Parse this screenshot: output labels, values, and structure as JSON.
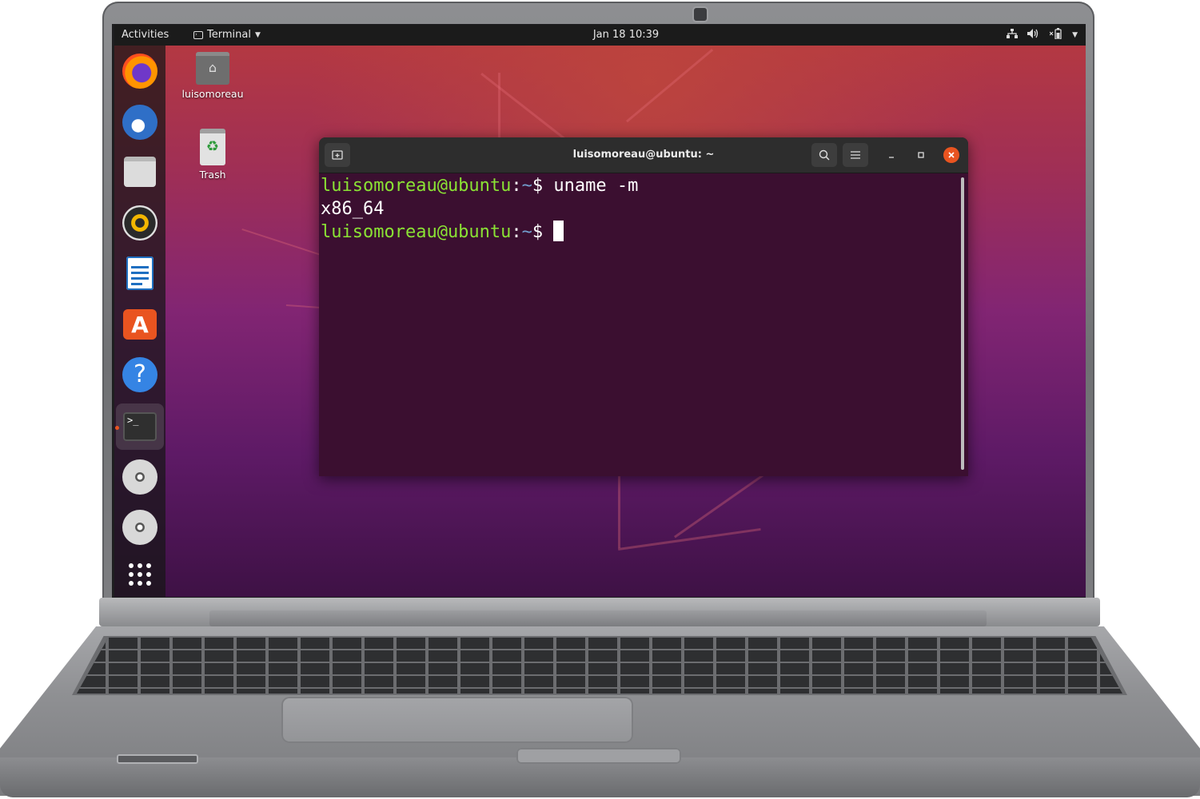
{
  "topbar": {
    "activities": "Activities",
    "app_menu": "Terminal",
    "clock": "Jan 18  10:39"
  },
  "dock": {
    "items": [
      {
        "name": "Firefox",
        "icon": "firefox-icon"
      },
      {
        "name": "Thunderbird",
        "icon": "thunderbird-icon"
      },
      {
        "name": "Files",
        "icon": "files-icon"
      },
      {
        "name": "Rhythmbox",
        "icon": "rhythmbox-icon"
      },
      {
        "name": "LibreOffice Writer",
        "icon": "writer-icon"
      },
      {
        "name": "Ubuntu Software",
        "icon": "software-center-icon"
      },
      {
        "name": "Help",
        "icon": "help-icon"
      },
      {
        "name": "Terminal",
        "icon": "terminal-icon",
        "active": true
      },
      {
        "name": "Disc",
        "icon": "disc-icon"
      },
      {
        "name": "Disc",
        "icon": "disc-icon"
      },
      {
        "name": "Show Applications",
        "icon": "app-grid-icon"
      }
    ]
  },
  "desktop": {
    "icons": [
      {
        "label": "luisomoreau",
        "icon": "home-folder-icon"
      },
      {
        "label": "Trash",
        "icon": "trash-icon"
      }
    ]
  },
  "terminal": {
    "title": "luisomoreau@ubuntu: ~",
    "lines": [
      {
        "user_host": "luisomoreau@ubuntu",
        "sep": ":",
        "path": "~",
        "prompt": "$ ",
        "command": "uname -m"
      },
      {
        "output": "x86_64"
      },
      {
        "user_host": "luisomoreau@ubuntu",
        "sep": ":",
        "path": "~",
        "prompt": "$ ",
        "command": ""
      }
    ]
  },
  "colors": {
    "ubuntu_orange": "#e95420",
    "prompt_green": "#8ae234",
    "path_blue": "#729fcf",
    "terminal_bg": "#3b0f30"
  }
}
